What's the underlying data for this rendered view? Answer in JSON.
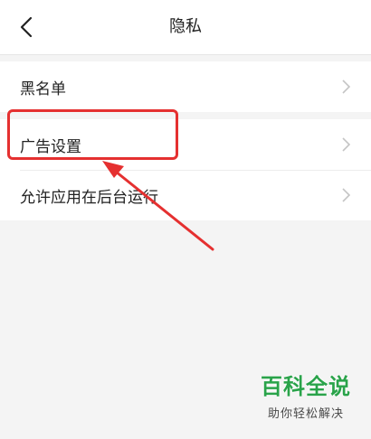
{
  "header": {
    "title": "隐私",
    "back_icon": "chevron-left-icon"
  },
  "settings": {
    "blacklist_label": "黑名单",
    "ad_settings_label": "广告设置",
    "background_run_label": "允许应用在后台运行",
    "row_icon": "chevron-right-icon"
  },
  "annotation": {
    "color": "#e53030",
    "target": "ad_settings"
  },
  "watermark": {
    "title": "百科全说",
    "subtitle": "助你轻松解决",
    "color": "#2aa34a"
  }
}
